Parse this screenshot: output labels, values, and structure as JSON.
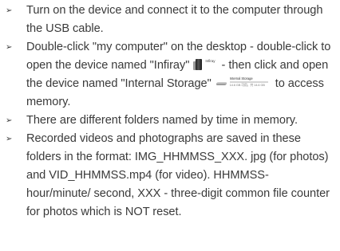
{
  "bullet_symbol": "➢",
  "items": [
    {
      "text": "Turn on the device and connect it to the computer through the USB cable."
    },
    {
      "part1": "Double-click \"my computer\" on the desktop - double-click to open the device named \"Infiray\"",
      "device_icon": "camera-device-icon",
      "device_caption": "Infiray",
      "part2": "- then click and open the device named \"Internal Storage\"",
      "storage_icon": "drive-icon",
      "storage_caption": "Internal Storage",
      "storage_free_text": "14.6 GB 可用，共 14.6 GB",
      "storage_used_fraction": 1.0,
      "part3": "to access memory."
    },
    {
      "text": "There are different folders named by time in memory."
    },
    {
      "text": "Recorded videos and photographs are saved in these folders in the format: IMG_HHMMSS_XXX. jpg (for photos) and VID_HHMMSS.mp4 (for video). HHMMSS- hour/minute/ second, XXX - three-digit common file counter for photos which is NOT reset."
    }
  ],
  "colors": {
    "text": "#3a3a3a",
    "background": "#ffffff",
    "storage_fill": "#6aa0d8"
  }
}
